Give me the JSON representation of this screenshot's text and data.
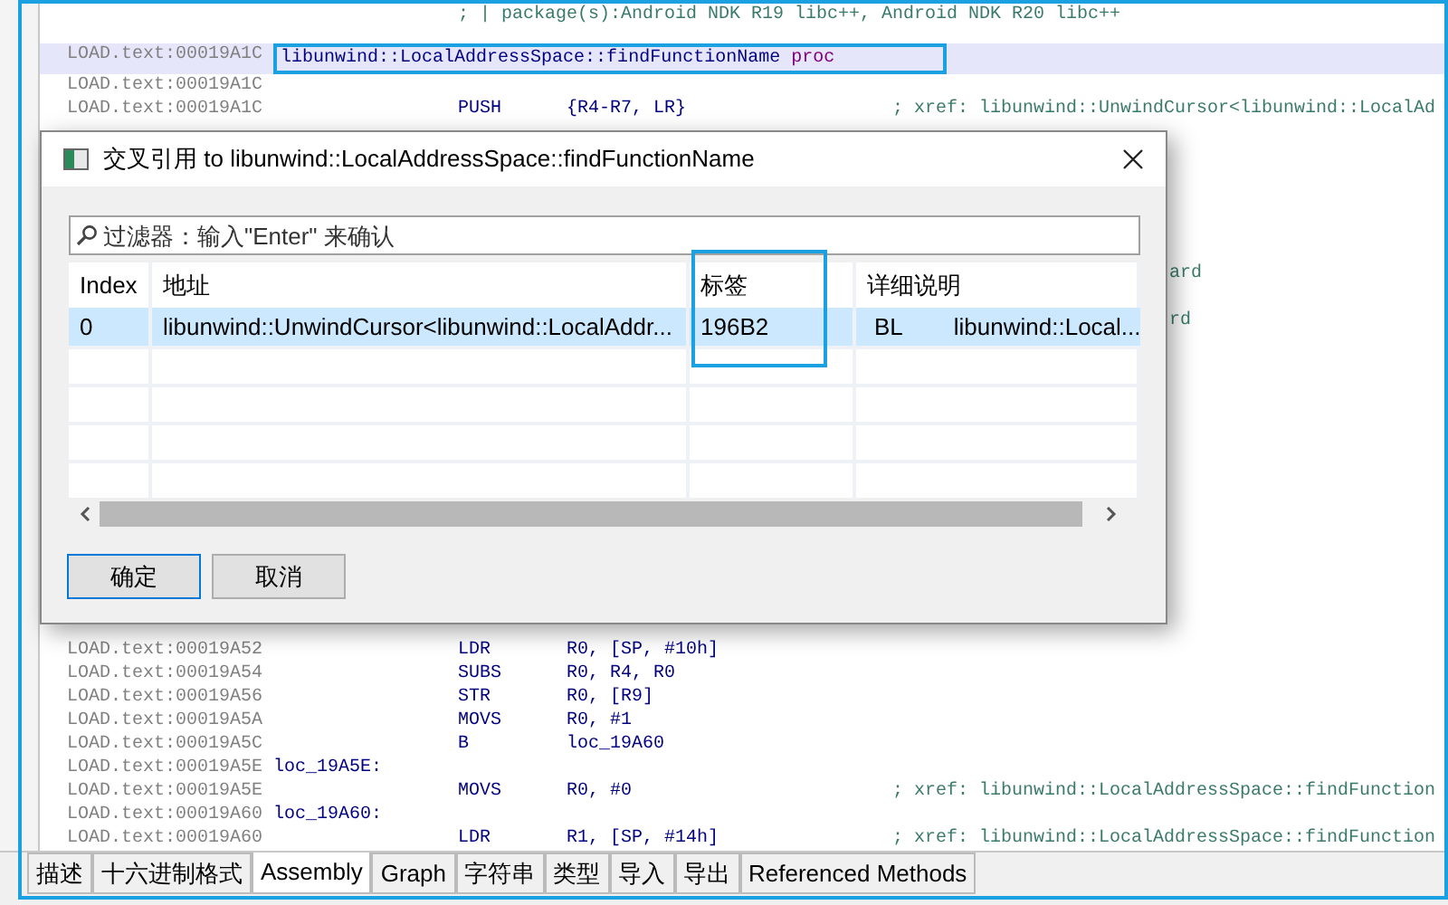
{
  "listing": {
    "rows": [
      {
        "kind": "note",
        "comment": "; | package(s):Android NDK R19 libc++, Android NDK R20 libc++"
      },
      {
        "kind": "blank"
      },
      {
        "kind": "code",
        "selected": true,
        "address": "LOAD.text:00019A1C",
        "label": "libunwind::LocalAddressSpace::findFunctionName",
        "keyword": "proc"
      },
      {
        "kind": "code",
        "selected": false,
        "address": "LOAD.text:00019A1C"
      },
      {
        "kind": "code",
        "selected": false,
        "address": "LOAD.text:00019A1C",
        "mnemonic": "PUSH",
        "operands": "{R4-R7, LR}",
        "comment": "; xref: libunwind::UnwindCursor<libunwind::LocalAd"
      },
      {
        "kind": "blank"
      },
      {
        "kind": "blank"
      },
      {
        "kind": "blank"
      },
      {
        "kind": "blank"
      },
      {
        "kind": "blank"
      },
      {
        "kind": "blank"
      },
      {
        "kind": "fragment",
        "comment": "ard"
      },
      {
        "kind": "blank"
      },
      {
        "kind": "fragment",
        "comment": "rd"
      },
      {
        "kind": "blank"
      },
      {
        "kind": "blank"
      },
      {
        "kind": "blank"
      },
      {
        "kind": "blank"
      },
      {
        "kind": "blank"
      },
      {
        "kind": "blank"
      },
      {
        "kind": "blank"
      },
      {
        "kind": "blank"
      },
      {
        "kind": "blank"
      },
      {
        "kind": "blank"
      },
      {
        "kind": "blank"
      },
      {
        "kind": "blank"
      },
      {
        "kind": "blank"
      },
      {
        "kind": "code",
        "selected": false,
        "address": "LOAD.text:00019A52",
        "mnemonic": "LDR",
        "operands": "R0, [SP, #10h]"
      },
      {
        "kind": "code",
        "selected": false,
        "address": "LOAD.text:00019A54",
        "mnemonic": "SUBS",
        "operands": "R0, R4, R0"
      },
      {
        "kind": "code",
        "selected": false,
        "address": "LOAD.text:00019A56",
        "mnemonic": "STR",
        "operands": "R0, [R9]"
      },
      {
        "kind": "code",
        "selected": false,
        "address": "LOAD.text:00019A5A",
        "mnemonic": "MOVS",
        "operands": "R0, #1"
      },
      {
        "kind": "code",
        "selected": false,
        "address": "LOAD.text:00019A5C",
        "mnemonic": "B",
        "operands": "loc_19A60"
      },
      {
        "kind": "code",
        "selected": false,
        "address": "LOAD.text:00019A5E",
        "label": "loc_19A5E:"
      },
      {
        "kind": "code",
        "selected": false,
        "address": "LOAD.text:00019A5E",
        "mnemonic": "MOVS",
        "operands": "R0, #0",
        "comment": "; xref: libunwind::LocalAddressSpace::findFunction"
      },
      {
        "kind": "code",
        "selected": false,
        "address": "LOAD.text:00019A60",
        "label": "loc_19A60:"
      },
      {
        "kind": "code",
        "selected": false,
        "address": "LOAD.text:00019A60",
        "mnemonic": "LDR",
        "operands": "R1, [SP, #14h]",
        "comment": "; xref: libunwind::LocalAddressSpace::findFunction"
      }
    ]
  },
  "dialog": {
    "title": "交叉引用 to libunwind::LocalAddressSpace::findFunctionName",
    "filter": {
      "placeholder": "过滤器：输入\"Enter\" 来确认"
    },
    "columns": [
      "Index",
      "地址",
      "标签",
      "详细说明"
    ],
    "rows": [
      {
        "selected": true,
        "index": "0",
        "address": "libunwind::UnwindCursor<libunwind::LocalAddr...",
        "label": "196B2",
        "detail_op": "BL",
        "detail_target": "libunwind::Local..."
      }
    ],
    "buttons": [
      {
        "label": "确定",
        "default": true
      },
      {
        "label": "取消",
        "default": false
      }
    ]
  },
  "tabs": [
    {
      "label": "描述",
      "selected": false
    },
    {
      "label": "十六进制格式",
      "selected": false
    },
    {
      "label": "Assembly",
      "selected": true
    },
    {
      "label": "Graph",
      "selected": false
    },
    {
      "label": "字符串",
      "selected": false
    },
    {
      "label": "类型",
      "selected": false
    },
    {
      "label": "导入",
      "selected": false
    },
    {
      "label": "导出",
      "selected": false
    },
    {
      "label": "Referenced Methods",
      "selected": false
    }
  ]
}
